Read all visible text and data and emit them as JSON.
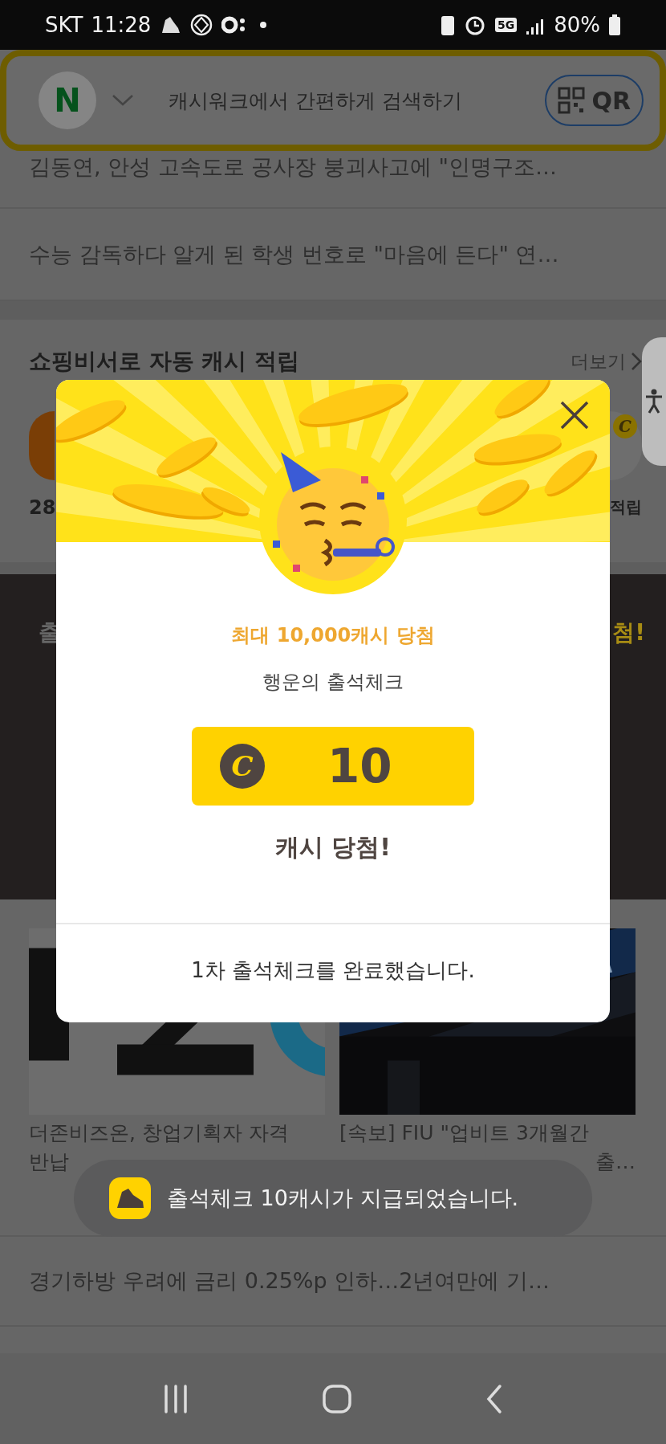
{
  "status_bar": {
    "carrier": "SKT",
    "time": "11:28",
    "network": "5G",
    "battery": "80%"
  },
  "search_bar": {
    "logo": "N",
    "placeholder": "캐시워크에서 간편하게 검색하기",
    "qr_label": "QR"
  },
  "news_top": [
    {
      "title": "김동연, 안성 고속도로 공사장 붕괴사고에 \"인명구조…"
    },
    {
      "title": "수능 감독하다 알게 된 학생 번호로 \"마음에 든다\" 연…"
    }
  ],
  "shopping": {
    "title": "쇼핑비서로 자동 캐시 적립",
    "more": "더보기",
    "left_label": "28",
    "right_label": "적립",
    "coin_symbol": "C"
  },
  "attendance_banner": {
    "left_text": "출",
    "right_text": "첨!"
  },
  "news_cards": [
    {
      "lines": [
        "더존비즈온, 창업기획자 자격",
        "반납"
      ]
    },
    {
      "lines": [
        "[속보] FIU \"업비트 3개월간",
        "출…"
      ]
    }
  ],
  "news_bottom": [
    {
      "title": "경기하방 우려에 금리 0.25%p 인하…2년여만에 기…"
    }
  ],
  "modal": {
    "headline": "최대 10,000캐시 당첨",
    "subtitle": "행운의 출석체크",
    "coin_symbol": "C",
    "amount": "10",
    "result": "캐시 당첨!",
    "footer": "1차 출석체크를 완료했습니다."
  },
  "toast": {
    "message": "출석체크 10캐시가 지급되었습니다."
  }
}
